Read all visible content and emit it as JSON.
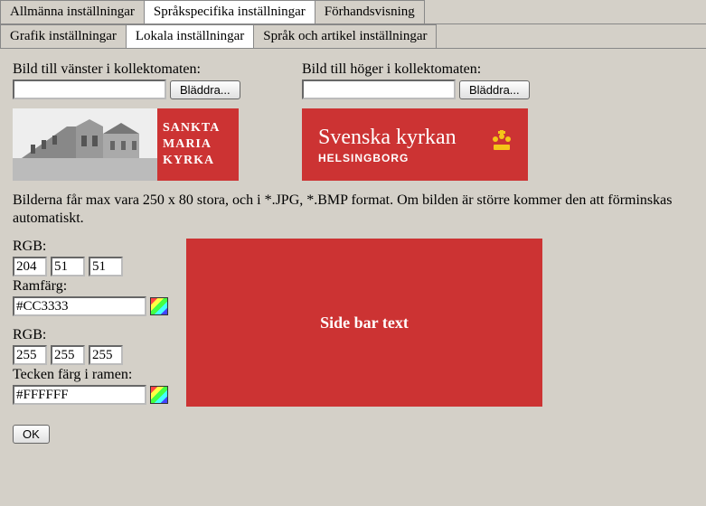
{
  "tabsTop": [
    {
      "label": "Allmänna inställningar",
      "active": false
    },
    {
      "label": "Språkspecifika inställningar",
      "active": true
    },
    {
      "label": "Förhandsvisning",
      "active": false
    }
  ],
  "tabsSub": [
    {
      "label": "Grafik inställningar",
      "active": false
    },
    {
      "label": "Lokala inställningar",
      "active": true
    },
    {
      "label": "Språk och artikel inställningar",
      "active": false
    }
  ],
  "left": {
    "label": "Bild till vänster i kollektomaten:",
    "path": "",
    "browse": "Bläddra...",
    "block": {
      "l1": "SANKTA",
      "l2": "MARIA",
      "l3": "KYRKA"
    }
  },
  "right": {
    "label": "Bild till höger i kollektomaten:",
    "path": "",
    "browse": "Bläddra...",
    "line1": "Svenska kyrkan",
    "line2": "HELSINGBORG"
  },
  "info": "Bilderna får max vara 250 x 80 stora, och i *.JPG, *.BMP format. Om bilden är större kommer den att förminskas automatiskt.",
  "frame": {
    "rgbLabel": "RGB:",
    "r": "204",
    "g": "51",
    "b": "51",
    "colorLabel": "Ramfärg:",
    "hex": "#CC3333"
  },
  "text": {
    "rgbLabel": "RGB:",
    "r": "255",
    "g": "255",
    "b": "255",
    "colorLabel": "Tecken färg i ramen:",
    "hex": "#FFFFFF"
  },
  "sidebarPreview": "Side bar text",
  "ok": "OK"
}
